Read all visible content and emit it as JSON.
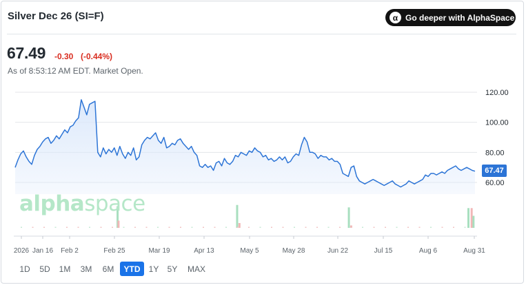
{
  "header": {
    "title": "Silver Dec 26 (SI=F)",
    "cta_label": "Go deeper with AlphaSpace",
    "cta_icon": "alpha-icon",
    "cta_glyph": "α"
  },
  "quote": {
    "price": "67.49",
    "change": "-0.30",
    "change_percent": "(-0.44%)",
    "as_of": "As of 8:53:12 AM EDT. Market Open.",
    "change_color": "#d92d20"
  },
  "watermark": {
    "text_bold": "alpha",
    "text_light": "space"
  },
  "ranges": [
    {
      "label": "1D",
      "active": false
    },
    {
      "label": "5D",
      "active": false
    },
    {
      "label": "1M",
      "active": false
    },
    {
      "label": "3M",
      "active": false
    },
    {
      "label": "6M",
      "active": false
    },
    {
      "label": "YTD",
      "active": true
    },
    {
      "label": "1Y",
      "active": false
    },
    {
      "label": "5Y",
      "active": false
    },
    {
      "label": "MAX",
      "active": false
    }
  ],
  "colors": {
    "line": "#2c74d6",
    "area_top": "#dbe8fb",
    "volume_up": "#a8dfbf",
    "volume_down": "#f1b7b7",
    "accent": "#1a73e8"
  },
  "chart_data": {
    "type": "area",
    "title": "",
    "ylim": [
      50,
      125
    ],
    "y_ticks": [
      "120.00",
      "100.00",
      "80.00",
      "60.00"
    ],
    "y_tick_values": [
      120,
      100,
      80,
      60
    ],
    "x_tick_labels": [
      "2026",
      "Jan 16",
      "Feb 2",
      "Feb 25",
      "Mar 19",
      "Apr 13",
      "May 5",
      "May 28",
      "Jun 22",
      "Jul 15",
      "Aug 6",
      "Aug 31"
    ],
    "last_value_label": "67.47",
    "series": [
      {
        "values": [
          70,
          75,
          79,
          81,
          77,
          74,
          72,
          78,
          82,
          84,
          87,
          89,
          90,
          86,
          88,
          91,
          89,
          92,
          95,
          93,
          97,
          98,
          101,
          103,
          115,
          110,
          105,
          112,
          113,
          114,
          80,
          77,
          83,
          79,
          82,
          80,
          83,
          78,
          84,
          79,
          76,
          80,
          78,
          83,
          75,
          77,
          85,
          88,
          90,
          89,
          91,
          93,
          88,
          86,
          90,
          83,
          84,
          86,
          85,
          88,
          89,
          86,
          84,
          82,
          84,
          80,
          78,
          71,
          70,
          72,
          70,
          71,
          68,
          73,
          74,
          71,
          76,
          73,
          72,
          74,
          78,
          77,
          80,
          79,
          78,
          81,
          80,
          83,
          81,
          80,
          77,
          78,
          75,
          76,
          74,
          75,
          77,
          75,
          77,
          73,
          74,
          77,
          79,
          78,
          85,
          90,
          87,
          80,
          80,
          79,
          76,
          78,
          77,
          77,
          75,
          76,
          74,
          74,
          72,
          66,
          65,
          64,
          70,
          71,
          64,
          61,
          60,
          59,
          60,
          61,
          62,
          61,
          60,
          59,
          58,
          59,
          60,
          61,
          59,
          58,
          57,
          58,
          59,
          61,
          60,
          59,
          60,
          61,
          62,
          65,
          64,
          66,
          66,
          65,
          66,
          67,
          66,
          68,
          69,
          70,
          71,
          69,
          68,
          69,
          70,
          69,
          68,
          67.47
        ]
      }
    ],
    "volume": {
      "up": [
        {
          "x": 0.22,
          "v": 0.05
        },
        {
          "x": 0.33,
          "v": 0.05
        },
        {
          "x": 0.39,
          "v": 0.05
        },
        {
          "x": 0.25,
          "v": 0.03
        },
        {
          "x": 0.64,
          "v": 0.04
        },
        {
          "x": 0.61,
          "v": 0.05
        },
        {
          "x": 0.615,
          "v": 0.05
        }
      ],
      "bars": [
        {
          "t": 0.222,
          "v": 0.9,
          "up": true
        },
        {
          "t": 0.224,
          "v": 0.3,
          "up": false
        },
        {
          "t": 0.482,
          "v": 0.95,
          "up": true
        },
        {
          "t": 0.487,
          "v": 0.2,
          "up": false
        },
        {
          "t": 0.725,
          "v": 0.85,
          "up": true
        },
        {
          "t": 0.73,
          "v": 0.1,
          "up": false
        },
        {
          "t": 0.985,
          "v": 0.82,
          "up": true
        },
        {
          "t": 0.992,
          "v": 0.82,
          "up": false
        },
        {
          "t": 0.996,
          "v": 0.5,
          "up": true
        }
      ]
    }
  }
}
